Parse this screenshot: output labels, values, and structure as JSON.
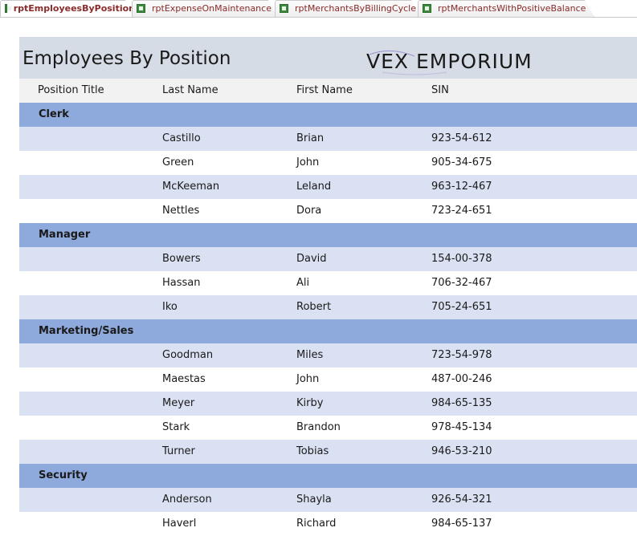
{
  "tabs": [
    {
      "label": "rptEmployeesByPosition",
      "active": true
    },
    {
      "label": "rptExpenseOnMaintenance",
      "active": false
    },
    {
      "label": "rptMerchantsByBillingCycle",
      "active": false
    },
    {
      "label": "rptMerchantsWithPositiveBalance",
      "active": false
    }
  ],
  "report": {
    "title": "Employees By Position",
    "logo_text": "VEX EMPORIUM",
    "columns": [
      "Position Title",
      "Last Name",
      "First Name",
      "SIN"
    ]
  },
  "groups": [
    {
      "position": "Clerk",
      "employees": [
        {
          "last": "Castillo",
          "first": "Brian",
          "sin": "923-54-612"
        },
        {
          "last": "Green",
          "first": "John",
          "sin": "905-34-675"
        },
        {
          "last": "McKeeman",
          "first": "Leland",
          "sin": "963-12-467"
        },
        {
          "last": "Nettles",
          "first": "Dora",
          "sin": "723-24-651"
        }
      ]
    },
    {
      "position": "Manager",
      "employees": [
        {
          "last": "Bowers",
          "first": "David",
          "sin": "154-00-378"
        },
        {
          "last": "Hassan",
          "first": "Ali",
          "sin": "706-32-467"
        },
        {
          "last": "Iko",
          "first": "Robert",
          "sin": "705-24-651"
        }
      ]
    },
    {
      "position": "Marketing/Sales",
      "employees": [
        {
          "last": "Goodman",
          "first": "Miles",
          "sin": "723-54-978"
        },
        {
          "last": "Maestas",
          "first": "John",
          "sin": "487-00-246"
        },
        {
          "last": "Meyer",
          "first": "Kirby",
          "sin": "984-65-135"
        },
        {
          "last": "Stark",
          "first": "Brandon",
          "sin": "978-45-134"
        },
        {
          "last": "Turner",
          "first": "Tobias",
          "sin": "946-53-210"
        }
      ]
    },
    {
      "position": "Security",
      "employees": [
        {
          "last": "Anderson",
          "first": "Shayla",
          "sin": "926-54-321"
        },
        {
          "last": "Haverl",
          "first": "Richard",
          "sin": "984-65-137"
        }
      ]
    }
  ],
  "colors": {
    "header_band": "#d6dce6",
    "group_band": "#8ea9db",
    "alt_row": "#d9e1f2",
    "tab_text": "#8a2a2a"
  }
}
